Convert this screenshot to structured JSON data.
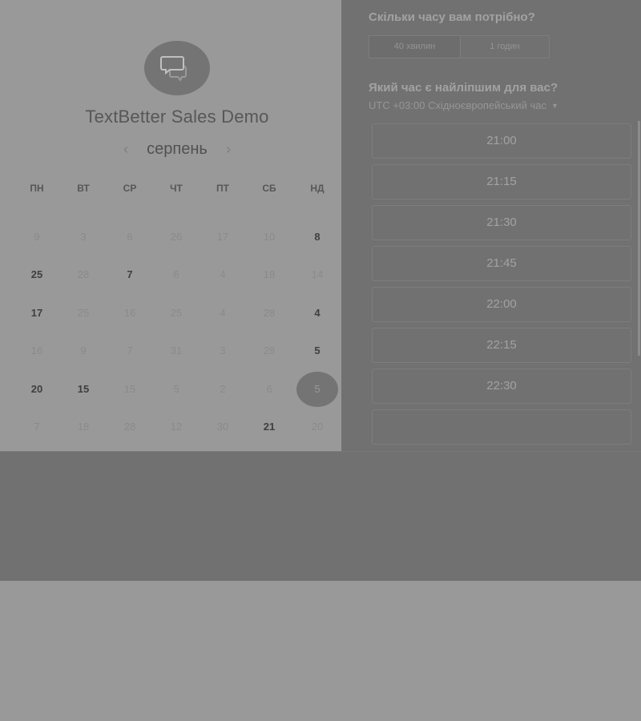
{
  "calendar": {
    "company_name": "TextBetter Sales Demo",
    "month": "серпень",
    "prev_icon": "chevron-left-icon",
    "next_icon": "chevron-right-icon",
    "weekdays": [
      "ПН",
      "ВТ",
      "СР",
      "ЧТ",
      "ПТ",
      "СБ",
      "НД"
    ],
    "weeks": [
      [
        "9",
        "3",
        "6",
        "26",
        "17",
        "10",
        "8"
      ],
      [
        "25",
        "28",
        "7",
        "6",
        "4",
        "18",
        "14"
      ],
      [
        "17",
        "25",
        "16",
        "25",
        "4",
        "28",
        "4"
      ],
      [
        "16",
        "9",
        "7",
        "31",
        "3",
        "28",
        "5"
      ],
      [
        "20",
        "15",
        "15",
        "5",
        "2",
        "6",
        "5"
      ],
      [
        "7",
        "18",
        "28",
        "12",
        "30",
        "21",
        "20"
      ]
    ],
    "available": [
      [
        0,
        6
      ],
      [
        1,
        0
      ],
      [
        1,
        2
      ],
      [
        2,
        0
      ],
      [
        2,
        6
      ],
      [
        3,
        6
      ],
      [
        4,
        0
      ],
      [
        4,
        1
      ],
      [
        5,
        5
      ]
    ],
    "selected": [
      4,
      6
    ]
  },
  "booking": {
    "duration_title": "Скільки часу вам потрібно?",
    "durations": [
      "40 хвилин",
      "1 годин"
    ],
    "time_title": "Який час є найліпшим для вас?",
    "timezone": "UTC +03:00 Східноєвропейський час",
    "slots": [
      "21:00",
      "21:15",
      "21:30",
      "21:45",
      "22:00",
      "22:15",
      "22:30"
    ]
  }
}
